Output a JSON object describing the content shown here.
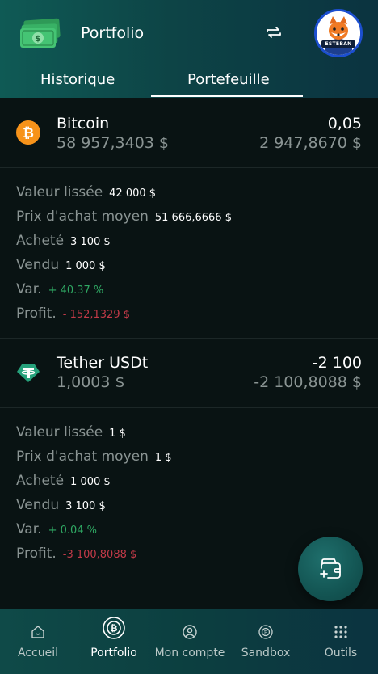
{
  "header": {
    "title": "Portfolio",
    "avatar_name": "ESTEBAN",
    "tabs": [
      {
        "label": "Historique",
        "active": false
      },
      {
        "label": "Portefeuille",
        "active": true
      }
    ]
  },
  "assets": [
    {
      "name": "Bitcoin",
      "icon": "bitcoin-icon",
      "color": "#f7931a",
      "price": "58 957,3403 $",
      "quantity": "0,05",
      "value": "2 947,8670 $",
      "details": {
        "smoothed_label": "Valeur lissée",
        "smoothed_value": "42 000 $",
        "avg_label": "Prix d'achat moyen",
        "avg_value": "51 666,6666 $",
        "bought_label": "Acheté",
        "bought_value": "3 100 $",
        "sold_label": "Vendu",
        "sold_value": "1 000 $",
        "var_label": "Var.",
        "var_value": "+ 40.37 %",
        "profit_label": "Profit.",
        "profit_value": "- 152,1329 $"
      }
    },
    {
      "name": "Tether USDt",
      "icon": "tether-icon",
      "color": "#26a17b",
      "price": "1,0003 $",
      "quantity": "-2 100",
      "value": "-2 100,8088 $",
      "details": {
        "smoothed_label": "Valeur lissée",
        "smoothed_value": "1 $",
        "avg_label": "Prix d'achat moyen",
        "avg_value": "1 $",
        "bought_label": "Acheté",
        "bought_value": "1 000 $",
        "sold_label": "Vendu",
        "sold_value": "3 100 $",
        "var_label": "Var.",
        "var_value": "+ 0.04 %",
        "profit_label": "Profit.",
        "profit_value": "-3 100,8088 $"
      }
    }
  ],
  "fab": {
    "icon": "wallet-add-icon"
  },
  "nav": [
    {
      "label": "Accueil",
      "icon": "home-icon",
      "active": false
    },
    {
      "label": "Portfolio",
      "icon": "portfolio-icon",
      "active": true
    },
    {
      "label": "Mon compte",
      "icon": "account-icon",
      "active": false
    },
    {
      "label": "Sandbox",
      "icon": "sandbox-icon",
      "active": false
    },
    {
      "label": "Outils",
      "icon": "grid-icon",
      "active": false
    }
  ],
  "colors": {
    "accent": "#0f5a55",
    "positive": "#2fa863",
    "negative": "#c23a48",
    "muted_text": "#8a9493"
  }
}
